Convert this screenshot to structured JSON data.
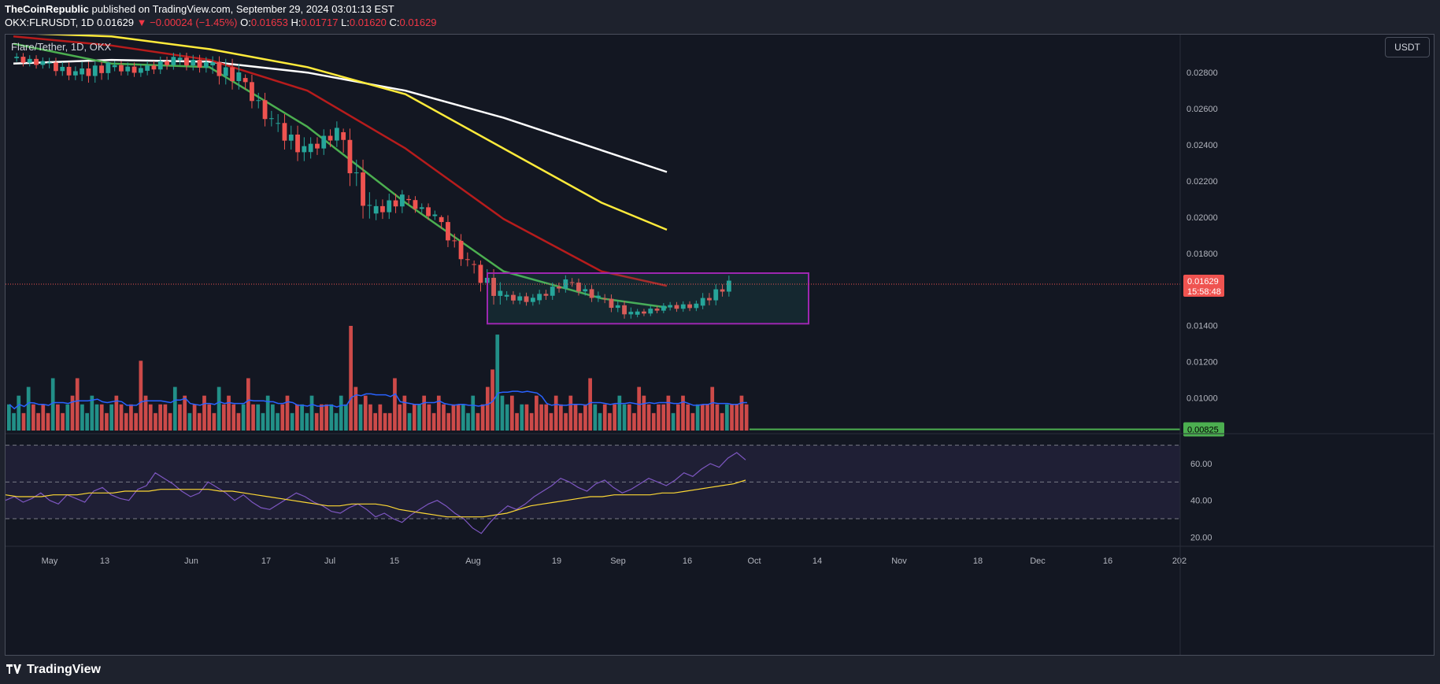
{
  "header": {
    "publisher": "TheCoinRepublic",
    "published_text": "published on TradingView.com, September 29, 2024 03:01:13 EST",
    "symbol": "OKX:FLRUSDT, 1D",
    "last": "0.01629",
    "change": "▼ −0.00024 (−1.45%)",
    "o_label": "O:",
    "o_value": "0.01653",
    "h_label": "H:",
    "h_value": "0.01717",
    "l_label": "L:",
    "l_value": "0.01620",
    "c_label": "C:",
    "c_value": "0.01629"
  },
  "chart_title": "Flare/Tether, 1D, OKX",
  "currency_button": "USDT",
  "footer": {
    "brand": "TradingView"
  },
  "colors": {
    "up": "#26a69a",
    "down": "#ef5350",
    "ma20": "#4caf50",
    "ma50": "#b71c1c",
    "ma100": "#ffeb3b",
    "ma200": "#ffffff",
    "box": "#9c27b0",
    "support": "#4caf50",
    "vol_ma": "#2962ff",
    "rsi": "#7e57c2",
    "rsi_ma": "#fdd835"
  },
  "chart_data": [
    {
      "type": "candlestick",
      "title": "Flare/Tether, 1D, OKX",
      "xlabel": "",
      "ylabel": "",
      "x_tick_labels": [
        "May",
        "13",
        "Jun",
        "17",
        "Jul",
        "15",
        "Aug",
        "19",
        "Sep",
        "16",
        "Oct",
        "14",
        "Nov",
        "18",
        "Dec",
        "16",
        "202"
      ],
      "y_tick_labels": [
        "0.02800",
        "0.02600",
        "0.02400",
        "0.02200",
        "0.02000",
        "0.01800",
        "0.01400",
        "0.01200",
        "0.01000"
      ],
      "ylim": [
        0.0081,
        0.0301
      ],
      "last_price_label": "0.01629",
      "countdown_label": "15:58:48",
      "support_level_label": "0.00825",
      "support_level": 0.00825,
      "consolidation_box": {
        "x_start": "Aug 4",
        "x_end": "Oct 3",
        "y_low": 0.0141,
        "y_high": 0.0169
      },
      "ohlc_weekly": [
        {
          "x": "Apr 29",
          "o": 0.0288,
          "h": 0.0296,
          "l": 0.0279,
          "c": 0.0285
        },
        {
          "x": "May 6",
          "o": 0.0285,
          "h": 0.0292,
          "l": 0.027,
          "c": 0.0279
        },
        {
          "x": "May 13",
          "o": 0.0279,
          "h": 0.0286,
          "l": 0.0255,
          "c": 0.0283
        },
        {
          "x": "May 20",
          "o": 0.0283,
          "h": 0.0292,
          "l": 0.0273,
          "c": 0.0281
        },
        {
          "x": "May 27",
          "o": 0.0281,
          "h": 0.0291,
          "l": 0.027,
          "c": 0.0287
        },
        {
          "x": "Jun 3",
          "o": 0.0287,
          "h": 0.0299,
          "l": 0.0276,
          "c": 0.0284
        },
        {
          "x": "Jun 10",
          "o": 0.0284,
          "h": 0.0289,
          "l": 0.025,
          "c": 0.0277
        },
        {
          "x": "Jun 17",
          "o": 0.0277,
          "h": 0.0279,
          "l": 0.0245,
          "c": 0.0252
        },
        {
          "x": "Jun 24",
          "o": 0.0252,
          "h": 0.0272,
          "l": 0.0231,
          "c": 0.0236
        },
        {
          "x": "Jul 1",
          "o": 0.0236,
          "h": 0.0254,
          "l": 0.0224,
          "c": 0.0247
        },
        {
          "x": "Jul 8",
          "o": 0.0247,
          "h": 0.0249,
          "l": 0.019,
          "c": 0.0202
        },
        {
          "x": "Jul 15",
          "o": 0.0202,
          "h": 0.0215,
          "l": 0.0184,
          "c": 0.021
        },
        {
          "x": "Jul 22",
          "o": 0.021,
          "h": 0.0213,
          "l": 0.0195,
          "c": 0.02
        },
        {
          "x": "Jul 29",
          "o": 0.02,
          "h": 0.0201,
          "l": 0.017,
          "c": 0.0174
        },
        {
          "x": "Aug 5",
          "o": 0.0174,
          "h": 0.0176,
          "l": 0.0136,
          "c": 0.0156
        },
        {
          "x": "Aug 12",
          "o": 0.0156,
          "h": 0.0168,
          "l": 0.0151,
          "c": 0.0154
        },
        {
          "x": "Aug 19",
          "o": 0.0154,
          "h": 0.0169,
          "l": 0.015,
          "c": 0.0164
        },
        {
          "x": "Aug 26",
          "o": 0.0164,
          "h": 0.017,
          "l": 0.0151,
          "c": 0.0155
        },
        {
          "x": "Sep 2",
          "o": 0.0155,
          "h": 0.0161,
          "l": 0.0141,
          "c": 0.0146
        },
        {
          "x": "Sep 9",
          "o": 0.0146,
          "h": 0.0154,
          "l": 0.0142,
          "c": 0.015
        },
        {
          "x": "Sep 16",
          "o": 0.015,
          "h": 0.0155,
          "l": 0.0141,
          "c": 0.0151
        },
        {
          "x": "Sep 23",
          "o": 0.0151,
          "h": 0.0172,
          "l": 0.0149,
          "c": 0.0163
        }
      ],
      "moving_averages": [
        {
          "x": "Apr 29",
          "ma20": 0.0296,
          "ma50": 0.03,
          "ma100": 0.0302,
          "ma200": 0.0285
        },
        {
          "x": "May 20",
          "ma20": 0.0285,
          "ma50": 0.0295,
          "ma100": 0.03,
          "ma200": 0.0287
        },
        {
          "x": "Jun 10",
          "ma20": 0.0283,
          "ma50": 0.0287,
          "ma100": 0.0293,
          "ma200": 0.0286
        },
        {
          "x": "Jul 1",
          "ma20": 0.025,
          "ma50": 0.027,
          "ma100": 0.0283,
          "ma200": 0.028
        },
        {
          "x": "Jul 22",
          "ma20": 0.0208,
          "ma50": 0.0238,
          "ma100": 0.0268,
          "ma200": 0.027
        },
        {
          "x": "Aug 12",
          "ma20": 0.017,
          "ma50": 0.0199,
          "ma100": 0.0238,
          "ma200": 0.0255
        },
        {
          "x": "Sep 2",
          "ma20": 0.0155,
          "ma50": 0.017,
          "ma100": 0.0208,
          "ma200": 0.0237
        },
        {
          "x": "Sep 16",
          "ma20": 0.015,
          "ma50": 0.0162,
          "ma100": 0.0193,
          "ma200": 0.0225
        },
        {
          "x": "Sep 29",
          "ma20": 0.0154,
          "ma50": 0.016,
          "ma100": 0.0181,
          "ma200": 0.0211
        }
      ]
    },
    {
      "type": "bar",
      "title": "Volume",
      "series": [
        {
          "values": [
            3,
            2,
            4,
            2,
            5,
            3,
            2,
            3,
            2,
            6,
            3,
            2,
            3,
            4,
            6,
            3,
            2,
            4,
            3,
            3,
            2,
            3,
            4,
            3,
            2,
            3,
            2,
            8,
            4,
            3,
            2,
            3,
            3,
            2,
            5,
            3,
            4,
            2,
            3,
            2,
            4,
            3,
            2,
            5,
            3,
            4,
            3,
            2,
            3,
            6,
            3,
            3,
            2,
            4,
            3,
            2,
            3,
            4,
            2,
            3,
            3,
            2,
            4,
            2,
            3,
            3,
            3,
            2,
            4,
            3,
            12,
            5,
            3,
            4,
            3,
            2,
            3,
            2,
            2,
            6,
            3,
            4,
            2,
            3,
            3,
            4,
            3,
            2,
            4,
            3,
            2,
            3,
            3,
            3,
            2,
            4,
            2,
            3,
            5,
            7,
            11,
            4,
            3,
            4,
            2,
            3,
            3,
            2,
            4,
            3,
            3,
            2,
            4,
            3,
            2,
            4,
            3,
            2,
            3,
            6,
            3,
            2,
            3,
            2,
            3,
            4,
            3,
            3,
            2,
            5,
            4,
            3,
            2,
            3,
            3,
            4,
            2,
            3,
            4,
            3,
            2,
            3,
            3,
            3,
            5,
            3,
            2,
            3,
            3,
            3,
            4,
            3
          ]
        }
      ]
    },
    {
      "type": "line",
      "title": "RSI",
      "y_tick_labels": [
        "60.00",
        "40.00",
        "20.00"
      ],
      "ylim": [
        15,
        75
      ],
      "bands": [
        30,
        50,
        70
      ],
      "series": [
        {
          "values": [
            40,
            42,
            39,
            41,
            44,
            40,
            38,
            43,
            41,
            39,
            45,
            47,
            43,
            41,
            40,
            46,
            48,
            55,
            52,
            49,
            45,
            42,
            44,
            50,
            47,
            44,
            40,
            43,
            39,
            36,
            35,
            38,
            41,
            44,
            42,
            39,
            37,
            34,
            33,
            36,
            38,
            35,
            31,
            33,
            30,
            28,
            32,
            35,
            38,
            40,
            37,
            33,
            30,
            25,
            22,
            28,
            33,
            37,
            35,
            38,
            42,
            45,
            48,
            52,
            50,
            47,
            45,
            49,
            51,
            47,
            44,
            46,
            49,
            52,
            50,
            48,
            51,
            55,
            53,
            57,
            60,
            58,
            63,
            66,
            62
          ]
        },
        {
          "values": [
            43,
            42,
            42,
            42,
            43,
            43,
            43,
            44,
            44,
            44,
            45,
            45,
            45,
            46,
            46,
            46,
            46,
            46,
            45,
            45,
            44,
            43,
            42,
            41,
            40,
            39,
            38,
            37,
            37,
            38,
            38,
            38,
            37,
            35,
            34,
            33,
            32,
            31,
            31,
            31,
            31,
            32,
            33,
            35,
            37,
            38,
            39,
            40,
            41,
            42,
            42,
            43,
            43,
            43,
            43,
            44,
            44,
            45,
            46,
            47,
            48,
            49,
            51
          ]
        }
      ]
    }
  ]
}
